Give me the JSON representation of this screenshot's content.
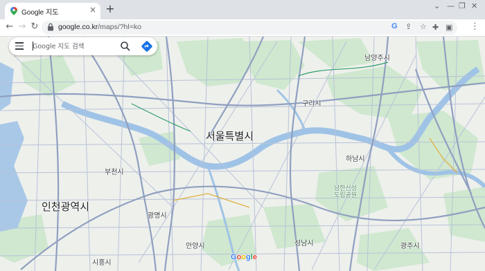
{
  "browser": {
    "tab_title": "Google 지도",
    "tab_close": "×",
    "new_tab": "+",
    "url_host": "google.co.kr",
    "url_path": "/maps/?hl=ko",
    "icons": [
      "back-icon",
      "forward-icon",
      "reload-icon",
      "lock-icon",
      "google-lens-icon",
      "share-icon",
      "bookmark-star-icon",
      "extensions-icon",
      "side-panel-icon",
      "menu-dots-icon"
    ]
  },
  "search": {
    "placeholder": "Google 지도 검색"
  },
  "map": {
    "labels": {
      "seoul": "서울특별시",
      "incheon": "인천광역시",
      "namyangju": "남양주시",
      "guri": "구리시",
      "hanam": "하남시",
      "bucheon": "부천시",
      "gwangmyeong": "광명시",
      "anyang": "안양시",
      "seongnam": "성남시",
      "gwangju": "광주시",
      "siheung": "시흥시",
      "namhansanseong": "남한산성\n도립공원"
    },
    "colors": {
      "land": "#eef0ec",
      "park": "#c8e6c9",
      "water": "#9fc3e6",
      "road": "#aab6d0",
      "highway": "#8f9fc0"
    }
  },
  "logo": {
    "G": "G",
    "o1": "o",
    "o2": "o",
    "g": "g",
    "l": "l",
    "e": "e"
  }
}
